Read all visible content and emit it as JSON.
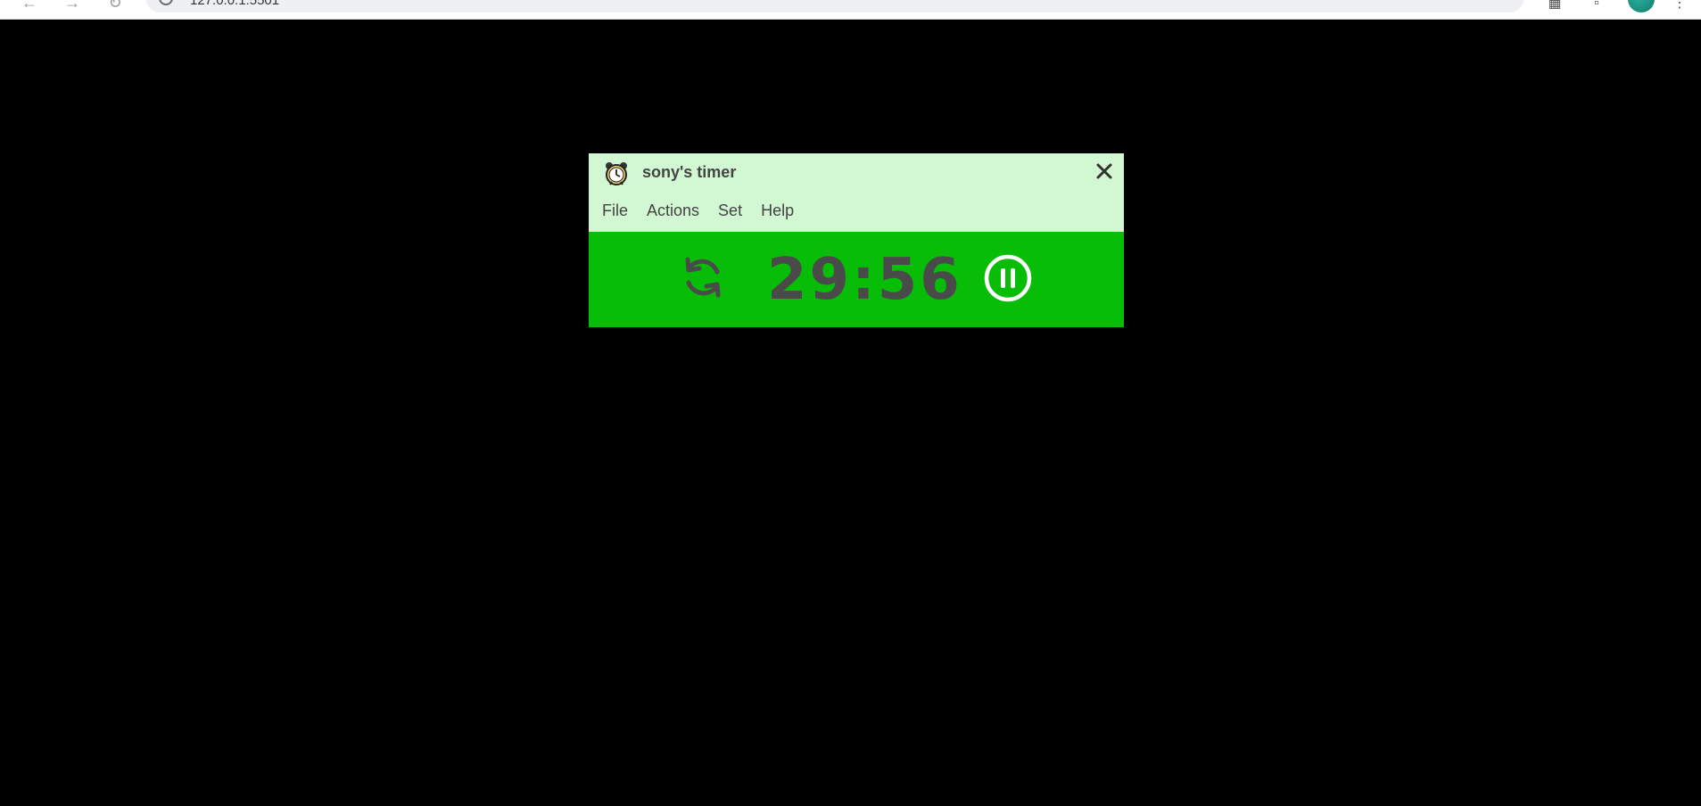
{
  "browser": {
    "url": "127.0.0.1:5501"
  },
  "window": {
    "title": "sony's timer",
    "menu": [
      {
        "label": "File"
      },
      {
        "label": "Actions"
      },
      {
        "label": "Set"
      },
      {
        "label": "Help"
      }
    ]
  },
  "timer": {
    "display": "29:56",
    "state": "running"
  },
  "colors": {
    "page_background": "#000000",
    "title_area": "#d1f7d3",
    "timer_body": "#07bd07",
    "text": "#444444"
  },
  "icons": {
    "app": "alarm-clock-icon",
    "close": "close-icon",
    "reset": "reset-icon",
    "pause": "pause-icon"
  }
}
